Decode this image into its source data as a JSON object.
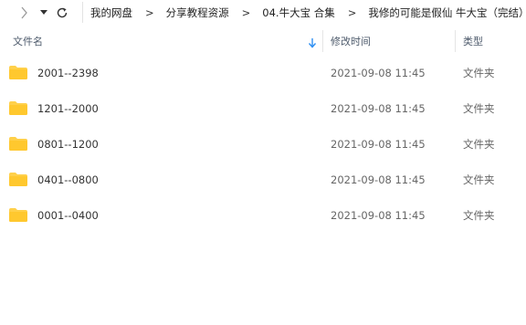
{
  "nav": {
    "back_icon": "chevron-left-icon",
    "recent_icon": "dropdown-arrow-icon",
    "refresh_icon": "refresh-icon"
  },
  "breadcrumb": {
    "items": [
      "我的网盘",
      "分享教程资源",
      "04.牛大宝 合集",
      "我修的可能是假仙 牛大宝（完结）"
    ],
    "separator": ">"
  },
  "columns": {
    "name": "文件名",
    "modified": "修改时间",
    "type": "类型"
  },
  "files": [
    {
      "name": "2001--2398",
      "modified": "2021-09-08 11:45",
      "type": "文件夹"
    },
    {
      "name": "1201--2000",
      "modified": "2021-09-08 11:45",
      "type": "文件夹"
    },
    {
      "name": "0801--1200",
      "modified": "2021-09-08 11:45",
      "type": "文件夹"
    },
    {
      "name": "0401--0800",
      "modified": "2021-09-08 11:45",
      "type": "文件夹"
    },
    {
      "name": "0001--0400",
      "modified": "2021-09-08 11:45",
      "type": "文件夹"
    }
  ],
  "colors": {
    "folder": "#FFD04A",
    "sort_arrow": "#2e8ff2"
  }
}
